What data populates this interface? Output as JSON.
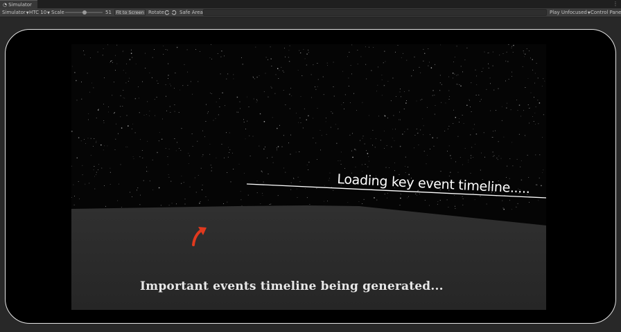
{
  "window": {
    "tab_title": "Simulator",
    "menu_glyph": "⋮"
  },
  "toolbar": {
    "mode_label": "Simulator",
    "device_label": "HTC 10",
    "scale_label": "Scale",
    "scale_value": "51",
    "scale_fraction": 0.51,
    "fit_button_label": "Fit to Screen",
    "rotate_label": "Rotate",
    "safe_area_label": "Safe Area",
    "play_mode_label": "Play Unfocused",
    "control_panel_label": "Control Panel"
  },
  "game": {
    "loading_text": "Loading key event timeline.....",
    "caption": "Important events timeline being generated..."
  },
  "colors": {
    "arrow": "#e0391e",
    "ground": "#2d2d2d",
    "sky": "#050505"
  },
  "icons": {
    "rotate_left": "rotate-left-icon",
    "rotate_right": "rotate-right-icon",
    "caret": "chevron-down-icon"
  }
}
